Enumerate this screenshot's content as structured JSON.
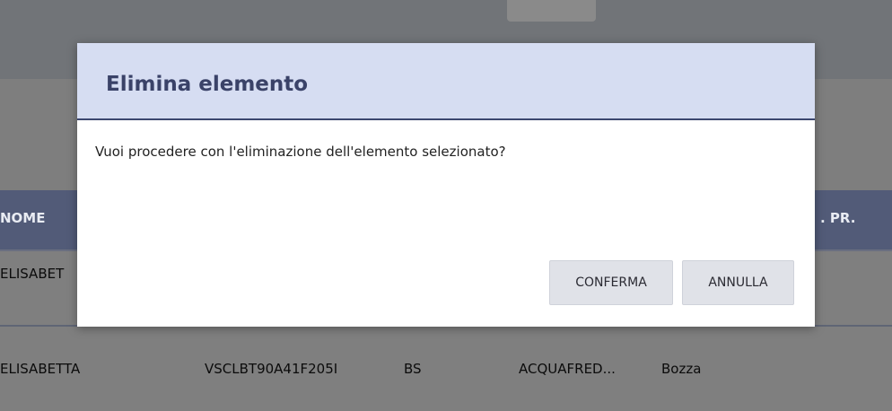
{
  "table": {
    "headers": {
      "nome": "NOME",
      "stato_pr": ". PR."
    },
    "rows": [
      {
        "nome": "ELISABET"
      },
      {
        "nome": "ELISABETTA",
        "codice_fiscale": "VSCLBT90A41F205I",
        "provincia": "BS",
        "comune": "ACQUAFRED...",
        "stato": "Bozza"
      }
    ]
  },
  "dialog": {
    "title": "Elimina elemento",
    "message": "Vuoi procedere con l'eliminazione dell'elemento selezionato?",
    "confirm_label": "CONFERMA",
    "cancel_label": "ANNULLA"
  },
  "colors": {
    "dialog_header_bg": "#d6ddf2",
    "dialog_title": "#3a4268",
    "table_header_bg": "#525b78",
    "overlay": "#7f7f7f"
  }
}
